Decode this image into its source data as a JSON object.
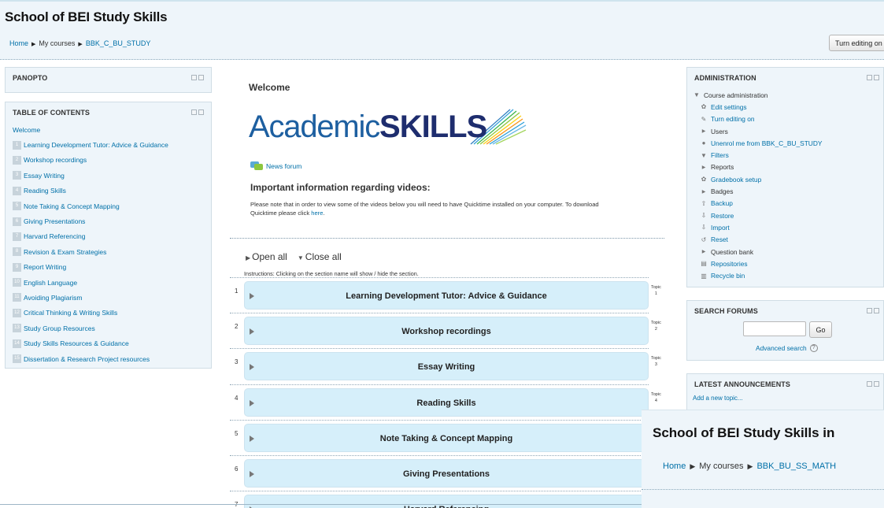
{
  "header": {
    "site_title": "School of BEI Study Skills",
    "breadcrumb": [
      "Home",
      "My courses",
      "BBK_C_BU_STUDY"
    ],
    "edit_button": "Turn editing on"
  },
  "panopto": {
    "title": "PANOPTO"
  },
  "toc": {
    "title": "TABLE OF CONTENTS",
    "welcome": "Welcome",
    "items": [
      {
        "num": "1",
        "label": "Learning Development Tutor: Advice & Guidance"
      },
      {
        "num": "2",
        "label": "Workshop recordings"
      },
      {
        "num": "3",
        "label": "Essay Writing"
      },
      {
        "num": "4",
        "label": "Reading Skills"
      },
      {
        "num": "5",
        "label": "Note Taking & Concept Mapping"
      },
      {
        "num": "6",
        "label": "Giving Presentations"
      },
      {
        "num": "7",
        "label": "Harvard Referencing"
      },
      {
        "num": "8",
        "label": "Revision & Exam Strategies"
      },
      {
        "num": "9",
        "label": "Report Writing"
      },
      {
        "num": "10",
        "label": "English Language"
      },
      {
        "num": "11",
        "label": "Avoiding Plagiarism"
      },
      {
        "num": "12",
        "label": "Critical Thinking & Writing Skills"
      },
      {
        "num": "13",
        "label": "Study Group Resources"
      },
      {
        "num": "14",
        "label": "Study Skills Resources & Guidance"
      },
      {
        "num": "15",
        "label": "Dissertation & Research Project resources"
      }
    ]
  },
  "main": {
    "welcome_heading": "Welcome",
    "logo": {
      "light": "Academic",
      "bold": "SKILLS"
    },
    "news_forum": "News forum",
    "important_heading": "Important information regarding videos:",
    "note_text": "Please note that in order to view some of the videos below you will need to have Quicktime installed on your computer.  To download Quicktime please click ",
    "note_link": "here",
    "note_end": ".",
    "open_all": "Open all",
    "close_all": "Close all",
    "instructions": "Instructions: Clicking on the section name will show / hide the section.",
    "topic_word": "Topic",
    "topics": [
      {
        "num": "1",
        "label": "Learning Development Tutor: Advice & Guidance"
      },
      {
        "num": "2",
        "label": "Workshop recordings"
      },
      {
        "num": "3",
        "label": "Essay Writing"
      },
      {
        "num": "4",
        "label": "Reading Skills"
      },
      {
        "num": "5",
        "label": "Note Taking & Concept Mapping"
      },
      {
        "num": "6",
        "label": "Giving Presentations"
      },
      {
        "num": "7",
        "label": "Harvard Referencing"
      }
    ]
  },
  "admin": {
    "title": "ADMINISTRATION",
    "course_admin": "Course administration",
    "items": [
      {
        "icon": "gear-icon",
        "label": "Edit settings",
        "link": true
      },
      {
        "icon": "pencil-icon",
        "label": "Turn editing on",
        "link": true
      },
      {
        "icon": "triangle-right-icon",
        "label": "Users",
        "link": false
      },
      {
        "icon": "user-icon",
        "label": "Unenrol me from BBK_C_BU_STUDY",
        "link": true
      },
      {
        "icon": "filter-icon",
        "label": "Filters",
        "link": true
      },
      {
        "icon": "triangle-right-icon",
        "label": "Reports",
        "link": false
      },
      {
        "icon": "gear-icon",
        "label": "Gradebook setup",
        "link": true
      },
      {
        "icon": "triangle-right-icon",
        "label": "Badges",
        "link": false
      },
      {
        "icon": "backup-icon",
        "label": "Backup",
        "link": true
      },
      {
        "icon": "restore-icon",
        "label": "Restore",
        "link": true
      },
      {
        "icon": "import-icon",
        "label": "Import",
        "link": true
      },
      {
        "icon": "reset-icon",
        "label": "Reset",
        "link": true
      },
      {
        "icon": "triangle-right-icon",
        "label": "Question bank",
        "link": false
      },
      {
        "icon": "repositories-icon",
        "label": "Repositories",
        "link": true
      },
      {
        "icon": "trash-icon",
        "label": "Recycle bin",
        "link": true
      }
    ]
  },
  "search_forums": {
    "title": "SEARCH FORUMS",
    "go": "Go",
    "advanced": "Advanced search",
    "help": "?"
  },
  "announcements": {
    "title": "LATEST ANNOUNCEMENTS",
    "add_topic": "Add a new topic..."
  },
  "overlay": {
    "title": "School of BEI Study Skills in",
    "breadcrumb": [
      "Home",
      "My courses",
      "BBK_BU_SS_MATH"
    ]
  },
  "colors": {
    "header_bg": "#eef5fa",
    "link": "#0070a8",
    "topic_bg": "#d6effa",
    "logo_dark": "#1e2d6e"
  }
}
